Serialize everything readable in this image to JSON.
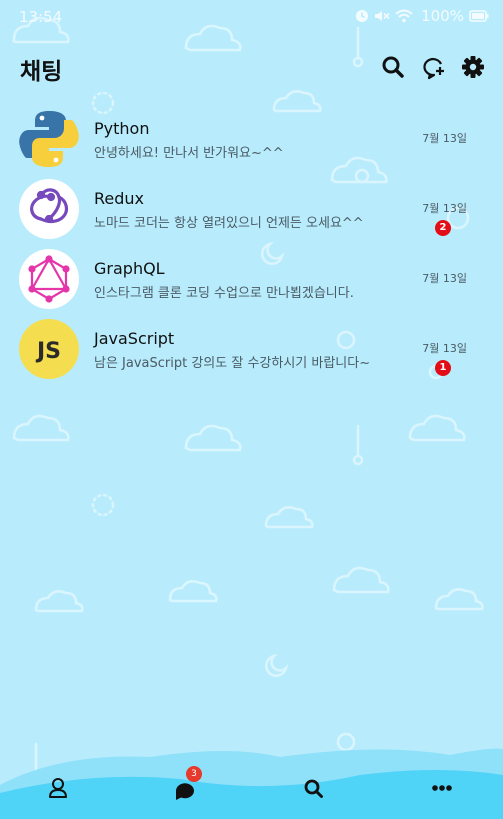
{
  "status_bar": {
    "time": "13:54",
    "battery_percent": "100%",
    "icons": [
      "alarm-icon",
      "mute-icon",
      "wifi-icon",
      "battery-icon"
    ]
  },
  "header": {
    "title": "채팅",
    "actions": [
      "search-icon",
      "new-chat-icon",
      "settings-icon"
    ]
  },
  "chats": [
    {
      "name": "Python",
      "preview": "안녕하세요! 만나서 반가워요~^^",
      "date": "7월 13일",
      "unread": null,
      "avatar": "python-logo"
    },
    {
      "name": "Redux",
      "preview": "노마드 코더는 항상 열려있으니 언제든 오세요^^",
      "date": "7월 13일",
      "unread": "2",
      "avatar": "redux-logo"
    },
    {
      "name": "GraphQL",
      "preview": "인스타그램 클론 코딩 수업으로 만나뵙겠습니다.",
      "date": "7월 13일",
      "unread": null,
      "avatar": "graphql-logo"
    },
    {
      "name": "JavaScript",
      "preview": "남은 JavaScript 강의도 잘 수강하시기 바랍니다~",
      "date": "7월 13일",
      "unread": "1",
      "avatar": "javascript-logo",
      "avatar_text": "JS"
    }
  ],
  "bottom_nav": {
    "items": [
      "profile-icon",
      "chat-icon",
      "search-icon",
      "more-icon"
    ],
    "chat_badge": "3"
  },
  "colors": {
    "background": "#b8ecfc",
    "wave": "#4fd3f7",
    "badge": "#e20d17",
    "js_yellow": "#f5dd50",
    "graphql_pink": "#e535ab",
    "redux_purple": "#764abc"
  }
}
